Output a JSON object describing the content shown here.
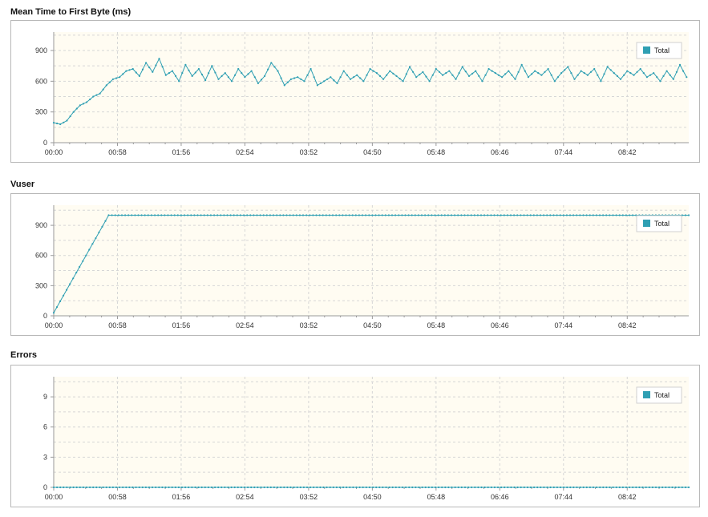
{
  "colors": {
    "series": "#2f9fb3",
    "plot_bg": "#fffcf2",
    "grid": "#d6d6d6",
    "axis": "#9a9a9a"
  },
  "chart_data": [
    {
      "type": "line",
      "title": "Mean Time to First Byte (ms)",
      "legend": "top-right",
      "grid": true,
      "x_ticks": [
        "00:00",
        "00:58",
        "01:56",
        "02:54",
        "03:52",
        "04:50",
        "05:48",
        "06:46",
        "07:44",
        "08:42"
      ],
      "y_ticks": [
        0,
        300,
        600,
        900
      ],
      "ylim": [
        0,
        1080
      ],
      "xlim_seconds": [
        0,
        578
      ],
      "series": [
        {
          "name": "Total",
          "x": [
            0,
            6,
            12,
            18,
            24,
            30,
            36,
            42,
            48,
            54,
            60,
            66,
            72,
            78,
            84,
            90,
            96,
            102,
            108,
            114,
            120,
            126,
            132,
            138,
            144,
            150,
            156,
            162,
            168,
            174,
            180,
            186,
            192,
            198,
            204,
            210,
            216,
            222,
            228,
            234,
            240,
            246,
            252,
            258,
            264,
            270,
            276,
            282,
            288,
            294,
            300,
            306,
            312,
            318,
            324,
            330,
            336,
            342,
            348,
            354,
            360,
            366,
            372,
            378,
            384,
            390,
            396,
            402,
            408,
            414,
            420,
            426,
            432,
            438,
            444,
            450,
            456,
            462,
            468,
            474,
            480,
            486,
            492,
            498,
            504,
            510,
            516,
            522,
            528,
            534,
            540,
            546,
            552,
            558,
            564,
            570,
            576
          ],
          "values": [
            195,
            180,
            215,
            300,
            365,
            395,
            450,
            480,
            560,
            620,
            640,
            700,
            720,
            650,
            780,
            690,
            820,
            660,
            700,
            600,
            760,
            650,
            720,
            610,
            750,
            620,
            680,
            600,
            720,
            640,
            700,
            580,
            650,
            780,
            700,
            560,
            620,
            640,
            600,
            720,
            560,
            600,
            640,
            580,
            700,
            620,
            660,
            600,
            720,
            680,
            620,
            700,
            650,
            600,
            740,
            640,
            690,
            600,
            720,
            660,
            700,
            620,
            740,
            650,
            700,
            600,
            720,
            680,
            640,
            700,
            620,
            760,
            640,
            700,
            660,
            720,
            600,
            680,
            740,
            620,
            700,
            660,
            720,
            600,
            740,
            680,
            620,
            700,
            660,
            720,
            640,
            680,
            600,
            700,
            620,
            760,
            640
          ]
        }
      ]
    },
    {
      "type": "line",
      "title": "Vuser",
      "legend": "top-right",
      "grid": true,
      "x_ticks": [
        "00:00",
        "00:58",
        "01:56",
        "02:54",
        "03:52",
        "04:50",
        "05:48",
        "06:46",
        "07:44",
        "08:42"
      ],
      "y_ticks": [
        0,
        300,
        600,
        900
      ],
      "ylim": [
        0,
        1100
      ],
      "xlim_seconds": [
        0,
        578
      ],
      "series": [
        {
          "name": "Total",
          "x": [
            0,
            50,
            578
          ],
          "values": [
            30,
            1000,
            1000
          ]
        }
      ]
    },
    {
      "type": "line",
      "title": "Errors",
      "legend": "top-right",
      "grid": true,
      "x_ticks": [
        "00:00",
        "00:58",
        "01:56",
        "02:54",
        "03:52",
        "04:50",
        "05:48",
        "06:46",
        "07:44",
        "08:42"
      ],
      "y_ticks": [
        0,
        3,
        6,
        9
      ],
      "ylim": [
        0,
        11
      ],
      "xlim_seconds": [
        0,
        578
      ],
      "series": [
        {
          "name": "Total",
          "x": [
            0,
            578
          ],
          "values": [
            0,
            0
          ]
        }
      ]
    }
  ]
}
